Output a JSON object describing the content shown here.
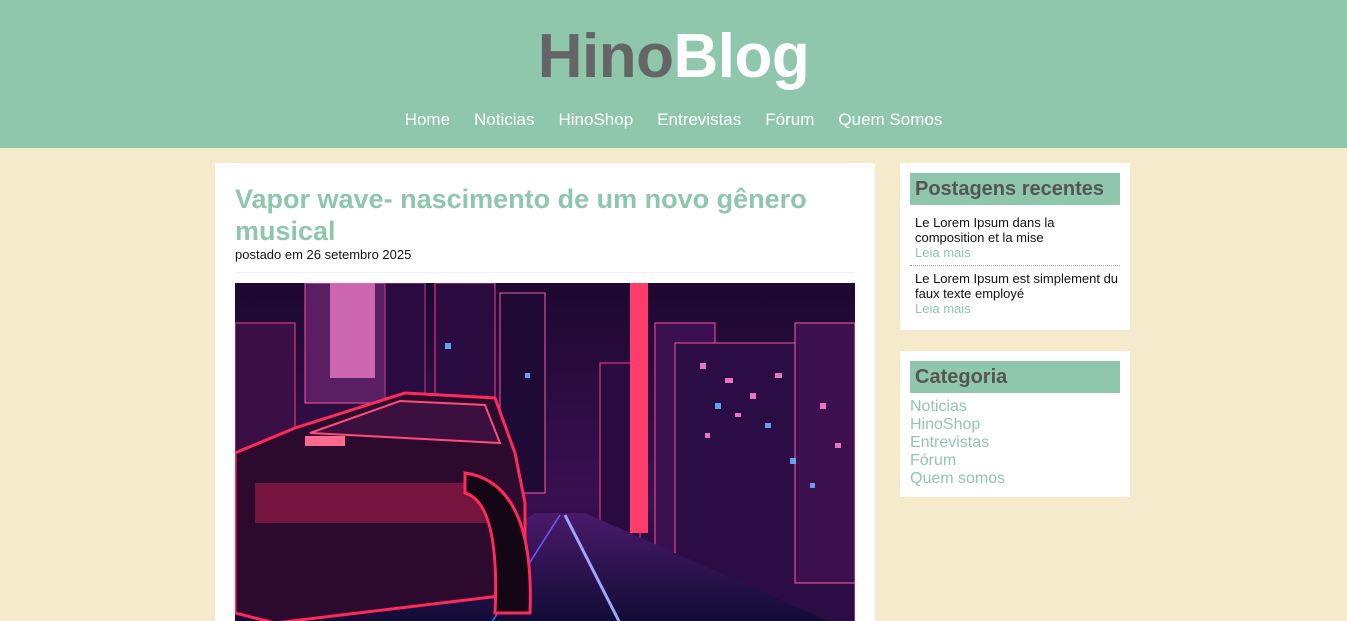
{
  "header": {
    "logo_part1": "Hino",
    "logo_part2": "Blog",
    "nav": [
      "Home",
      "Noticias",
      "HinoShop",
      "Entrevistas",
      "Fórum",
      "Quem Somos"
    ]
  },
  "post": {
    "title": "Vapor wave- nascimento de um novo gênero musical",
    "meta": "postado em 26 setembro 2025"
  },
  "recent": {
    "title": "Postagens recentes",
    "items": [
      {
        "text": "Le Lorem Ipsum dans la composition et la mise",
        "more": "Leia mais"
      },
      {
        "text": "Le Lorem Ipsum est simplement du faux texte employé",
        "more": "Leia mais"
      }
    ]
  },
  "categories": {
    "title": "Categoria",
    "items": [
      "Noticias",
      "HinoShop",
      "Entrevistas",
      "Fórum",
      "Quem somos"
    ]
  },
  "colors": {
    "header_bg": "#8fc7ac",
    "page_bg": "#f5ebcc",
    "logo_dark": "#656565",
    "accent": "#8fc7ac"
  }
}
